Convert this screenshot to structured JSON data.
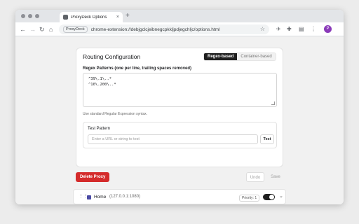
{
  "browser": {
    "tab": {
      "title": "ProxyDeck Options",
      "close_glyph": "×"
    },
    "new_tab_glyph": "+",
    "nav_glyphs": {
      "back": "←",
      "forward": "→",
      "reload": "↻",
      "home": "⌂"
    },
    "site_chip": "ProxyDeck",
    "url": "chrome-extension://debjgclcjeibnegcpkkljpdjegchljc/options.html",
    "star_glyph": "☆",
    "toolbar_icons": {
      "puzzle": "✚",
      "sidebar": "▤",
      "menu": "⋮"
    },
    "avatar_letter": "P"
  },
  "routing": {
    "title": "Routing Configuration",
    "modes": [
      "Regex-based",
      "Container-based"
    ],
    "active_mode": "Regex-based",
    "patterns_label": "Regex Patterns (one per line, trailing spaces removed)",
    "patterns": [
      "^39\\.1\\..*",
      "^10\\.200\\..*"
    ],
    "hint": "Use standard Regular Expression syntax.",
    "test": {
      "label": "Test Pattern",
      "placeholder": "Enter a URL or string to test",
      "button": "Test"
    }
  },
  "actions": {
    "delete": "Delete Proxy",
    "undo": "Undo",
    "save": "Save"
  },
  "proxy_row": {
    "handle_glyph": "⋮⋮",
    "name": "Home",
    "host": "(127.0.0.1:1080)",
    "priority": "Priority: 1",
    "enabled": true,
    "chevron_glyph": "⌄"
  },
  "colors": {
    "accent": "#1f1f1f",
    "danger": "#d42b2b",
    "proxy_color": "#4b4ba4"
  }
}
